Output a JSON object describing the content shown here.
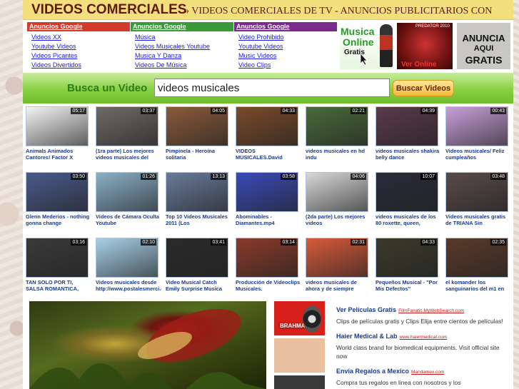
{
  "header": {
    "title": "VIDEOS COMERCIALES",
    "subtitle": "» VIDEOS COMERCIALES DE TV - ANUNCIOS PUBLICITARIOS CON"
  },
  "ad_blocks": [
    {
      "heading": "Anuncios Google",
      "color": "#d23a2a",
      "items": [
        "Videos XX",
        "Youtube Videos",
        "Videos Picantes",
        "Videos Divertidos"
      ]
    },
    {
      "heading": "Anuncios Google",
      "color": "#3a9a3a",
      "items": [
        "Música",
        "Videos Musicales Youtube",
        "Musica Y Danza",
        "Videos De Música"
      ]
    },
    {
      "heading": "Anuncios Google",
      "color": "#7a2a8c",
      "items": [
        "Video Prohibido",
        "Youtube Videos",
        "Music Videos",
        "Video Clips"
      ]
    }
  ],
  "banners": {
    "musica": {
      "line1": "Musica",
      "line2": "Online",
      "line3": "Gratis"
    },
    "predator": {
      "title": "PREDATOR 2010",
      "bottom": "Ver Online"
    },
    "anuncia": {
      "line1": "ANUNCIA",
      "line2": "AQUI",
      "line3": "GRATIS"
    }
  },
  "search": {
    "label": "Busca un Video",
    "value": "videos musicales",
    "button": "Buscar Videos"
  },
  "videos": [
    {
      "title": "Animals Animados Cantores! Factor X",
      "duration": "05:17",
      "bg": "#f4f4f4"
    },
    {
      "title": "(1ra parte) Los mejores videos musicales del",
      "duration": "03:37",
      "bg": "#6e6a66"
    },
    {
      "title": "Pimpinela - Heroína solitaria",
      "duration": "04:05",
      "bg": "#8a5a3a"
    },
    {
      "title": "VIDEOS MUSICALES.David",
      "duration": "04:33",
      "bg": "#7a4a2a"
    },
    {
      "title": "videos musicales en hd indu",
      "duration": "02:21",
      "bg": "#4a6a3a"
    },
    {
      "title": "videos musicales shakira belly dance",
      "duration": "04:39",
      "bg": "#5a3a4a"
    },
    {
      "title": "Videos musicales/ Feliz cumpleaños",
      "duration": "00:43",
      "bg": "#c8a0d8"
    },
    {
      "title": "Glenn Mederios - nothing gonna change",
      "duration": "03:50",
      "bg": "#4a5a8a"
    },
    {
      "title": "Videos de Cámara Oculta Youtube",
      "duration": "01:26",
      "bg": "#8ab0c8"
    },
    {
      "title": "Top 10 Videos Musicales 2011 (Los",
      "duration": "13:13",
      "bg": "#6a7a9a"
    },
    {
      "title": "Abominables - Diamantes.mp4",
      "duration": "03:58",
      "bg": "#3a4ab8"
    },
    {
      "title": "(2da parte) Los mejores videos",
      "duration": "04:06",
      "bg": "#d8d8d8"
    },
    {
      "title": "videos musicales de los 80 roxette, queen,",
      "duration": "10:07",
      "bg": "#2a2a3a"
    },
    {
      "title": "Videos musicales gratis de TRIANA Sin",
      "duration": "03:48",
      "bg": "#5a4a4a"
    },
    {
      "title": "TAN SOLO POR TI, SALSA ROMANTICA,",
      "duration": "03:16",
      "bg": "#3a3a3a"
    },
    {
      "title": "Videos musicales desde http://www.postalesmerci.com",
      "duration": "02:10",
      "bg": "#a8d0e8"
    },
    {
      "title": "Video Musical Catch Emily Surprise Musica",
      "duration": "03:41",
      "bg": "#2a2a2a"
    },
    {
      "title": "Producción de Videoclips Musicales.",
      "duration": "03:14",
      "bg": "#8a3a2a"
    },
    {
      "title": "videos musicales de ahora y de siempre",
      "duration": "02:31",
      "bg": "#d85a3a"
    },
    {
      "title": "Pequeños Musical - \"Por Mis Defectos\"",
      "duration": "04:33",
      "bg": "#3a3a2a"
    },
    {
      "title": "el komander los sanguinarios del m1 en",
      "duration": "02:35",
      "bg": "#5a3a2a"
    }
  ],
  "side_thumbs": [
    {
      "name": "brahma-ad",
      "label": "BRAHMA",
      "bg": "#d8201a"
    },
    {
      "name": "cartoon-thumb",
      "label": "",
      "bg": "#e8c0a0"
    },
    {
      "name": "dark-thumb",
      "label": "",
      "bg": "#3a3a3a"
    }
  ],
  "text_ads": [
    {
      "title": "Ver Películas Gratis",
      "url": "FilmFanatic.MyWebSearch.com",
      "desc": "Clips de películas gratis y Clips Elija entre cientos de películas!"
    },
    {
      "title": "Haier Medical & Lab",
      "url": "www.haiermedical.com",
      "desc": "World class brand for biomedical equipments. Visit official site now"
    },
    {
      "title": "Envia Regalos a Mexico",
      "url": "Mandamex.com",
      "desc": "Compra tus regalos en linea con nosotros y los"
    }
  ]
}
